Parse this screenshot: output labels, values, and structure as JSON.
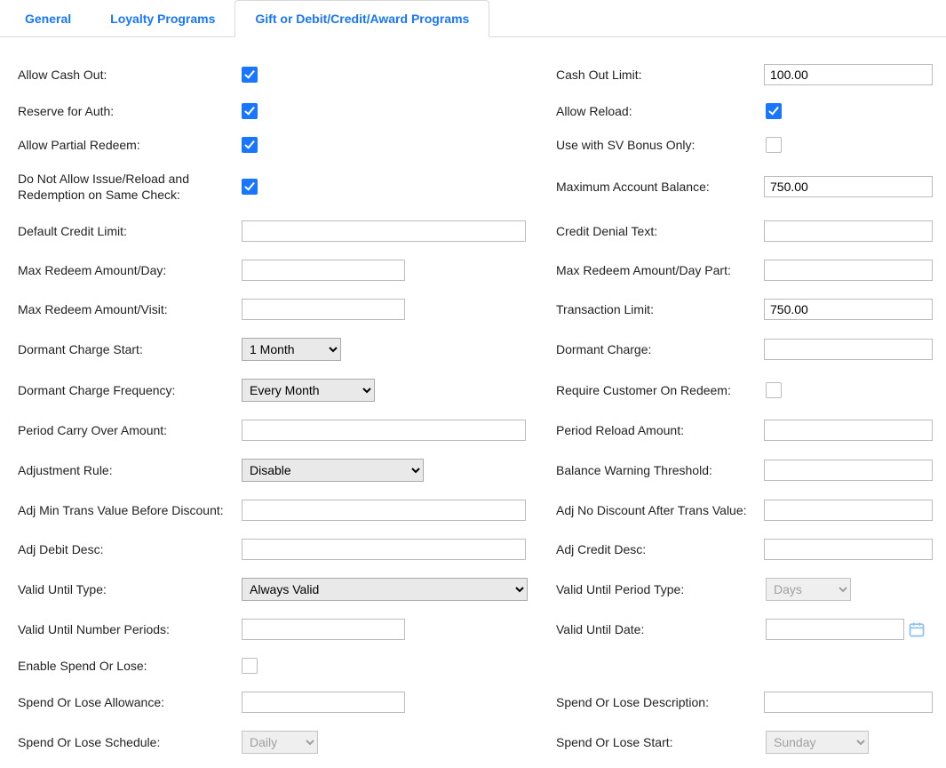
{
  "tabs": {
    "general": "General",
    "loyalty": "Loyalty Programs",
    "gift": "Gift or Debit/Credit/Award Programs"
  },
  "labels": {
    "allowCashOut": "Allow Cash Out:",
    "cashOutLimit": "Cash Out Limit:",
    "reserveAuth": "Reserve for Auth:",
    "allowReload": "Allow Reload:",
    "allowPartial": "Allow Partial Redeem:",
    "svBonus": "Use with SV Bonus Only:",
    "noIssueReload": "Do Not Allow Issue/Reload and Redemption on Same Check:",
    "maxBalance": "Maximum Account Balance:",
    "defCredit": "Default Credit Limit:",
    "creditDenial": "Credit Denial Text:",
    "maxRedeemDay": "Max Redeem Amount/Day:",
    "maxRedeemDayPart": "Max Redeem Amount/Day Part:",
    "maxRedeemVisit": "Max Redeem Amount/Visit:",
    "transLimit": "Transaction Limit:",
    "dormStart": "Dormant Charge Start:",
    "dormCharge": "Dormant Charge:",
    "dormFreq": "Dormant Charge Frequency:",
    "reqCustomer": "Require Customer On Redeem:",
    "periodCarry": "Period Carry Over Amount:",
    "periodReload": "Period Reload Amount:",
    "adjRule": "Adjustment Rule:",
    "balWarn": "Balance Warning Threshold:",
    "adjMin": "Adj Min Trans Value Before Discount:",
    "adjNoDisc": "Adj No Discount After Trans Value:",
    "adjDebit": "Adj Debit Desc:",
    "adjCredit": "Adj Credit Desc:",
    "validType": "Valid Until Type:",
    "validPeriodType": "Valid Until Period Type:",
    "validNum": "Valid Until Number Periods:",
    "validDate": "Valid Until Date:",
    "enableSpend": "Enable Spend Or Lose:",
    "spendAllow": "Spend Or Lose Allowance:",
    "spendDesc": "Spend Or Lose Description:",
    "spendSched": "Spend Or Lose Schedule:",
    "spendStart": "Spend Or Lose Start:"
  },
  "values": {
    "cashOutLimit": "100.00",
    "maxBalance": "750.00",
    "transLimit": "750.00",
    "defCredit": "",
    "creditDenial": "",
    "maxRedeemDay": "",
    "maxRedeemDayPart": "",
    "maxRedeemVisit": "",
    "dormCharge": "",
    "periodCarry": "",
    "periodReload": "",
    "balWarn": "",
    "adjMin": "",
    "adjNoDisc": "",
    "adjDebit": "",
    "adjCredit": "",
    "validNum": "",
    "validDate": "",
    "spendAllow": "",
    "spendDesc": ""
  },
  "selects": {
    "dormStart": "1 Month",
    "dormFreq": "Every Month",
    "adjRule": "Disable",
    "validType": "Always Valid",
    "validPeriodType": "Days",
    "spendSched": "Daily",
    "spendStart": "Sunday"
  },
  "checks": {
    "allowCashOut": true,
    "reserveAuth": true,
    "allowReload": true,
    "allowPartial": true,
    "svBonus": false,
    "noIssueReload": true,
    "reqCustomer": false,
    "enableSpend": false
  }
}
